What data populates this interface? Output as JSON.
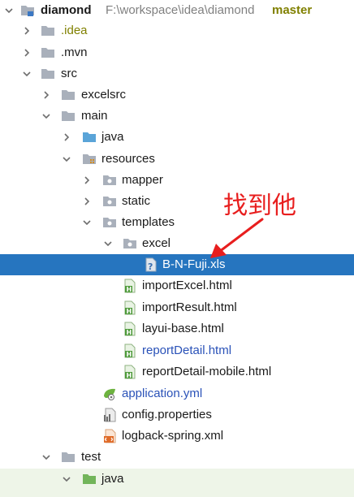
{
  "project": {
    "name": "diamond",
    "path": "F:\\workspace\\idea\\diamond",
    "branch": "master"
  },
  "tree": {
    "idea": ".idea",
    "mvn": ".mvn",
    "src": "src",
    "excelsrc": "excelsrc",
    "main": "main",
    "java": "java",
    "resources": "resources",
    "mapper": "mapper",
    "static": "static",
    "templates": "templates",
    "excel": "excel",
    "selected_file": "B-N-Fuji.xls",
    "html_files": [
      "importExcel.html",
      "importResult.html",
      "layui-base.html",
      "reportDetail.html",
      "reportDetail-mobile.html"
    ],
    "application": "application.yml",
    "config": "config.properties",
    "logback": "logback-spring.xml",
    "test": "test",
    "test_java": "java"
  },
  "annotation": {
    "text": "找到他",
    "color": "#e81e1e"
  },
  "colors": {
    "selection": "#2675bf",
    "folder": "#a9b0bb",
    "source_folder": "#5aa4d8",
    "test_folder": "#72b55a",
    "modified_file": "#2a52b8"
  }
}
